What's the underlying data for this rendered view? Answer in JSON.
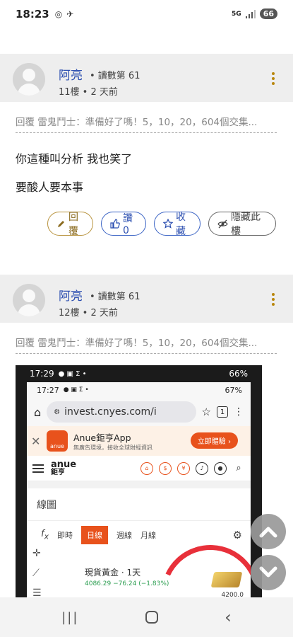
{
  "status_bar": {
    "time": "18:23",
    "signal_text": "5G",
    "battery": "66"
  },
  "posts": [
    {
      "author": "阿亮",
      "reads": "• 讀數第 61",
      "floor": "11樓 • 2 天前",
      "quote": "回覆 雷鬼鬥士：準備好了嗎！5，10，20，604個交集...",
      "lines": [
        "你這種叫分析 我也笑了",
        "要酸人要本事"
      ],
      "actions": {
        "reply": "回覆",
        "like": "讚 0",
        "favorite": "收藏",
        "hide": "隱藏此樓"
      }
    },
    {
      "author": "阿亮",
      "reads": "• 讀數第 61",
      "floor": "12樓 • 2 天前",
      "quote": "回覆 雷鬼鬥士：準備好了嗎！5，10，20，604個交集..."
    }
  ],
  "embedded_screenshot": {
    "outer_time": "17:29",
    "outer_battery": "66%",
    "inner_time": "17:27",
    "inner_battery": "67%",
    "url": "invest.cnyes.com/i",
    "tab_count": "1",
    "ad_title": "Anue鉅亨App",
    "ad_subtitle": "無廣告環境，接收全球財經資訊",
    "ad_cta": "立即體驗 ›",
    "brand_top": "anue",
    "brand_bottom": "鉅亨",
    "section_title": "線圖",
    "chart_tabs": [
      "即時",
      "日線",
      "週線",
      "月線"
    ],
    "active_tab": "日線",
    "ticker_name": "現貨黃金 · 1天",
    "ticker_price": "4086.29 −76.24 (−1.83%)",
    "price_label": "4200.0"
  },
  "nav": {
    "recents": "|||",
    "back": "‹"
  }
}
